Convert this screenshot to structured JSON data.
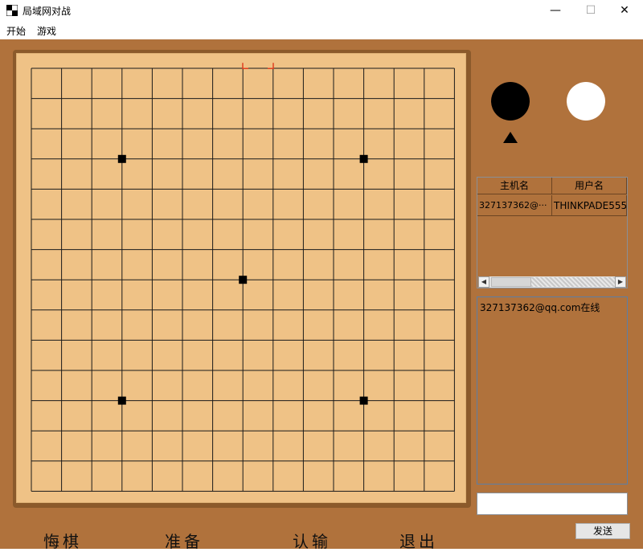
{
  "window": {
    "title": "局域网对战",
    "controls": {
      "minimize": "—",
      "maximize": "☐",
      "close": "✕"
    }
  },
  "menu": [
    "开始",
    "游戏"
  ],
  "board": {
    "grid_lines": 15,
    "star_points": [
      [
        3,
        3
      ],
      [
        11,
        3
      ],
      [
        7,
        7
      ],
      [
        3,
        11
      ],
      [
        11,
        11
      ]
    ],
    "cursor": {
      "col": 7.5,
      "row": -0.5
    },
    "colors": {
      "wood": "#efc286",
      "frame": "#8b5a2b",
      "line": "#1a1a1a",
      "cursor": "#e04020"
    }
  },
  "players": {
    "black_stone": "black",
    "white_stone": "white",
    "current_turn": "black"
  },
  "user_table": {
    "headers": [
      "主机名",
      "用户名"
    ],
    "rows": [
      [
        "327137362@···",
        "THINKPADE555"
      ]
    ]
  },
  "chat": {
    "messages": [
      "327137362@qq.com在线"
    ],
    "input_value": "",
    "send_label": "发送"
  },
  "actions": [
    "悔棋",
    "准备",
    "认输",
    "退出"
  ],
  "colors": {
    "background": "#b0723c"
  }
}
